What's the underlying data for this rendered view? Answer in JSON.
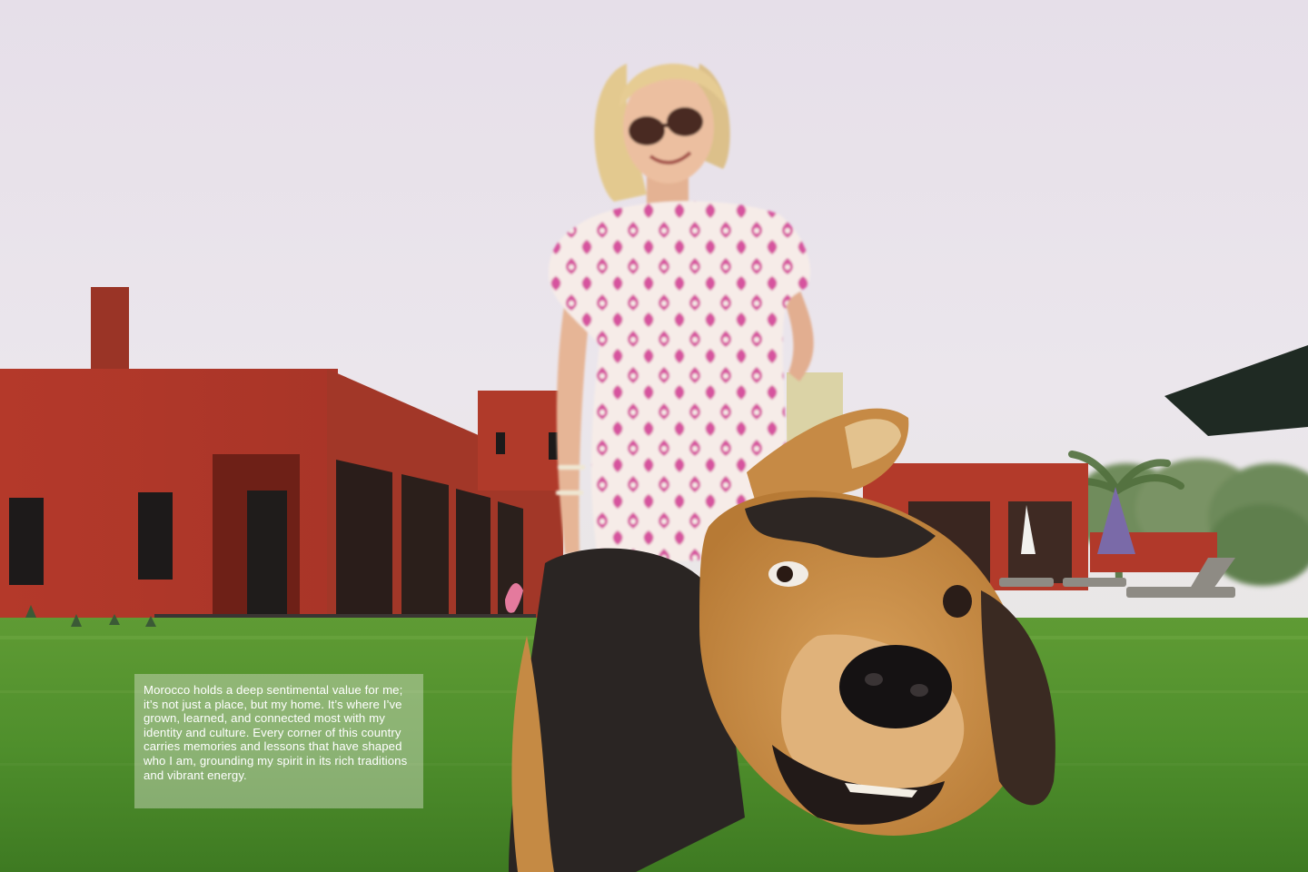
{
  "caption": {
    "text": "Morocco holds a deep sentimental value for me; it’s not just a place, but my home. It’s where I’ve grown, learned, and connected most with my identity and culture. Every corner of this country carries memories and lessons that have shaped who I am, grounding my spirit in its rich traditions and vibrant energy."
  },
  "palette": {
    "sky": "#e8e2ea",
    "lawn": "#4a8a2a",
    "building": "#b83c2a",
    "dress_pink": "#d94f9c",
    "dog_tan": "#c98a3e",
    "dog_black": "#26211f"
  }
}
